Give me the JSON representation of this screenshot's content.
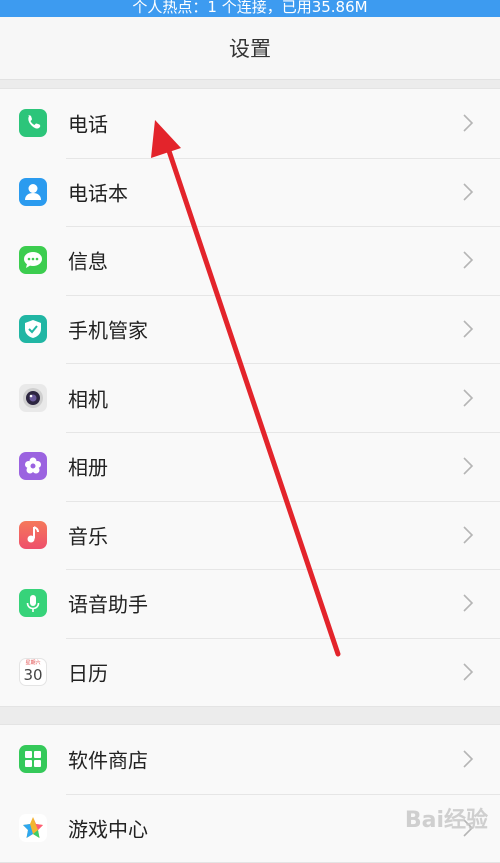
{
  "status_bar": {
    "text": "个人热点：1 个连接，已用35.86M"
  },
  "header": {
    "title": "设置"
  },
  "group1": [
    {
      "label": "电话",
      "icon": "phone-icon",
      "color": "#2cc57a"
    },
    {
      "label": "电话本",
      "icon": "contacts-icon",
      "color": "#2b9bef"
    },
    {
      "label": "信息",
      "icon": "message-icon",
      "color": "#3ccd4f"
    },
    {
      "label": "手机管家",
      "icon": "security-shield-icon",
      "color": "#21b6a4"
    },
    {
      "label": "相机",
      "icon": "camera-icon",
      "color": "#d6d6d6"
    },
    {
      "label": "相册",
      "icon": "gallery-flower-icon",
      "color": "#9b63e0"
    },
    {
      "label": "音乐",
      "icon": "music-note-icon",
      "color": "#f26b5f"
    },
    {
      "label": "语音助手",
      "icon": "microphone-icon",
      "color": "#37d37a"
    },
    {
      "label": "日历",
      "icon": "calendar-icon",
      "color": "#ffffff",
      "day": "30",
      "weekday": "星期六"
    }
  ],
  "group2": [
    {
      "label": "软件商店",
      "icon": "app-store-icon",
      "color": "#35c95a"
    },
    {
      "label": "游戏中心",
      "icon": "game-center-icon",
      "color": "#ffffff"
    }
  ],
  "watermark": "Bai经验"
}
